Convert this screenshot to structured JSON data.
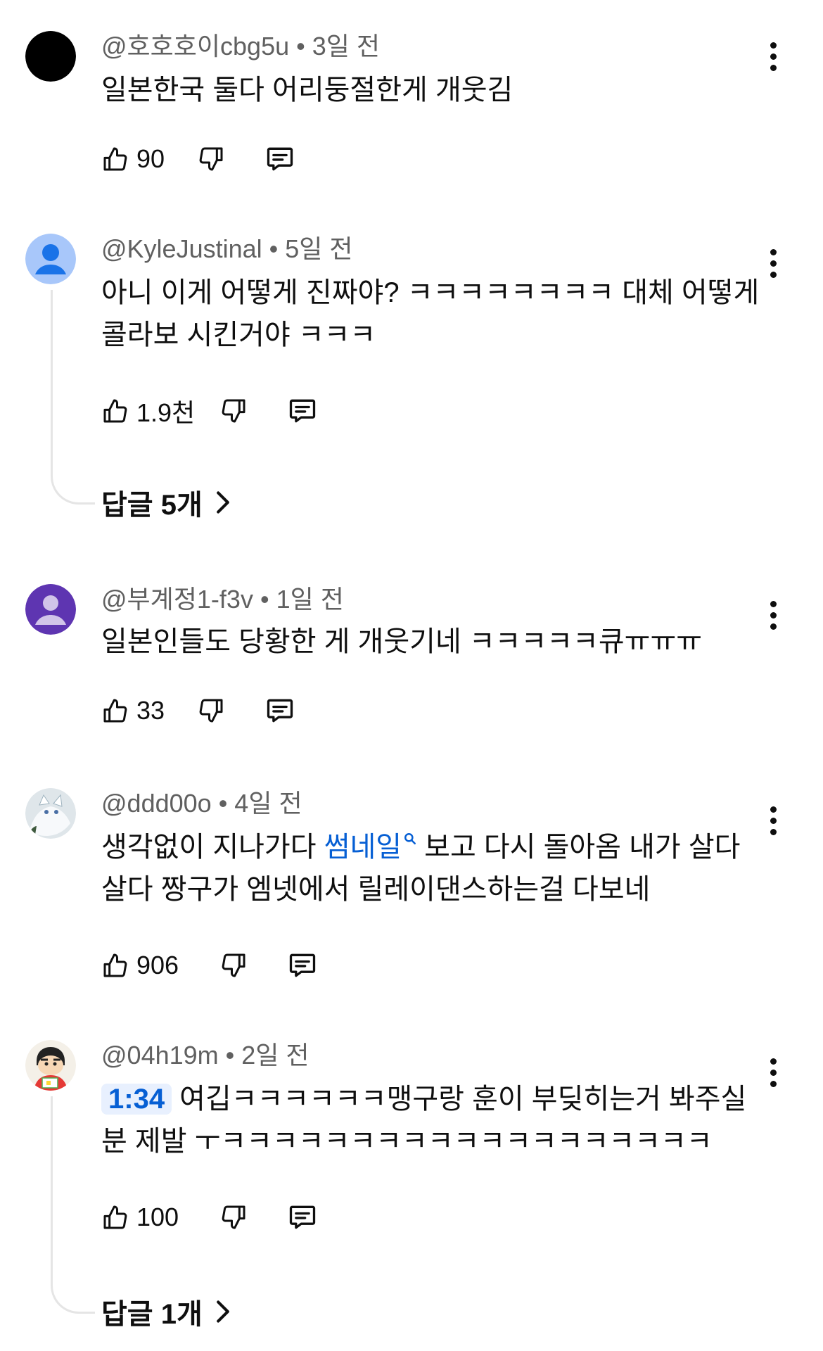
{
  "comments": [
    {
      "author": "@호호호이cbg5u",
      "time": "3일 전",
      "lines": [
        "일본한국 둘다 어리둥절한게 개웃김"
      ],
      "likes": "90",
      "avatar": "black-circle"
    },
    {
      "author": "@KyleJustinal",
      "time": "5일 전",
      "lines": [
        "아니 이게 어떻게 진짜야? ㅋㅋㅋㅋㅋㅋㅋㅋ 대체 어떻게",
        "콜라보 시킨거야 ㅋㅋㅋ"
      ],
      "likes": "1.9천",
      "replies": "답글 5개",
      "avatar": "default-person-blue"
    },
    {
      "author": "@부계정1-f3v",
      "time": "1일 전",
      "lines": [
        "일본인들도 당황한 게 개웃기네 ㅋㅋㅋㅋㅋ큐ㅠㅠㅠ"
      ],
      "likes": "33",
      "avatar": "default-person-purple"
    },
    {
      "author": "@ddd00o",
      "time": "4일 전",
      "line1_prefix": "생각없이 지나가다 ",
      "line1_link": "썸네일",
      "line1_suffix": " 보고 다시 돌아옴  내가 살다",
      "line2": "살다 짱구가 엠넷에서 릴레이댄스하는걸 다보네",
      "likes": "906",
      "avatar": "white-fox-image"
    },
    {
      "author": "@04h19m",
      "time": "2일 전",
      "timestamp": "1:34",
      "line1_text": " 여깁ㅋㅋㅋㅋㅋㅋ맹구랑 훈이 부딪히는거 봐주실",
      "line2": "분 제발 ㅜㅋㅋㅋㅋㅋㅋㅋㅋㅋㅋㅋㅋㅋㅋㅋㅋㅋㅋㅋ",
      "likes": "100",
      "replies": "답글 1개",
      "avatar": "cartoon-boy-image"
    }
  ],
  "icons": {
    "like": "thumbs-up-icon",
    "dislike": "thumbs-down-icon",
    "reply": "comment-icon",
    "more": "more-vertical-icon",
    "chevron": "chevron-right-icon",
    "search": "search-icon"
  },
  "colors": {
    "text": "#0f0f0f",
    "meta": "#606060",
    "link": "#065fd4",
    "thread": "#e5e5e5"
  }
}
